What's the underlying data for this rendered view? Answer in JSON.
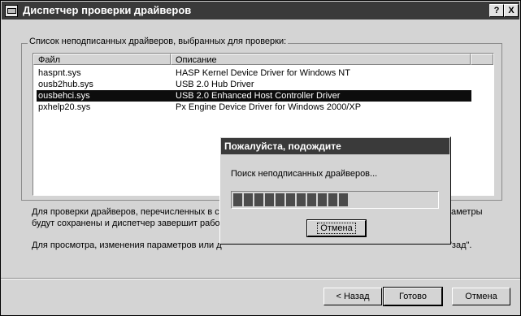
{
  "window": {
    "title": "Диспетчер проверки драйверов",
    "help_button": "?",
    "close_button": "X"
  },
  "group": {
    "label": "Список неподписанных драйверов, выбранных для проверки:"
  },
  "list": {
    "columns": [
      "Файл",
      "Описание"
    ],
    "rows": [
      {
        "file": "haspnt.sys",
        "description": "HASP Kernel Device Driver for Windows NT",
        "selected": false
      },
      {
        "file": "ousb2hub.sys",
        "description": "USB 2.0 Hub Driver",
        "selected": false
      },
      {
        "file": "ousbehci.sys",
        "description": "USB 2.0 Enhanced Host Controller Driver",
        "selected": true
      },
      {
        "file": "pxhelp20.sys",
        "description": "Px Engine Device Driver for Windows 2000/XP",
        "selected": false
      }
    ]
  },
  "info": {
    "line1_left": "Для проверки драйверов, перечисленных в с",
    "line1_right": "аметры",
    "line2_left": "будут сохранены и диспетчер завершит работ",
    "line3_left": "Для просмотра, изменения параметров или д",
    "line3_right": "\"зад\"."
  },
  "buttons": {
    "back": "< Назад",
    "finish": "Готово",
    "cancel": "Отмена"
  },
  "progress_dialog": {
    "title": "Пожалуйста, подождите",
    "message": "Поиск неподписанных драйверов...",
    "progress_blocks": 11,
    "progress_fraction": 0.55,
    "cancel": "Отмена"
  }
}
